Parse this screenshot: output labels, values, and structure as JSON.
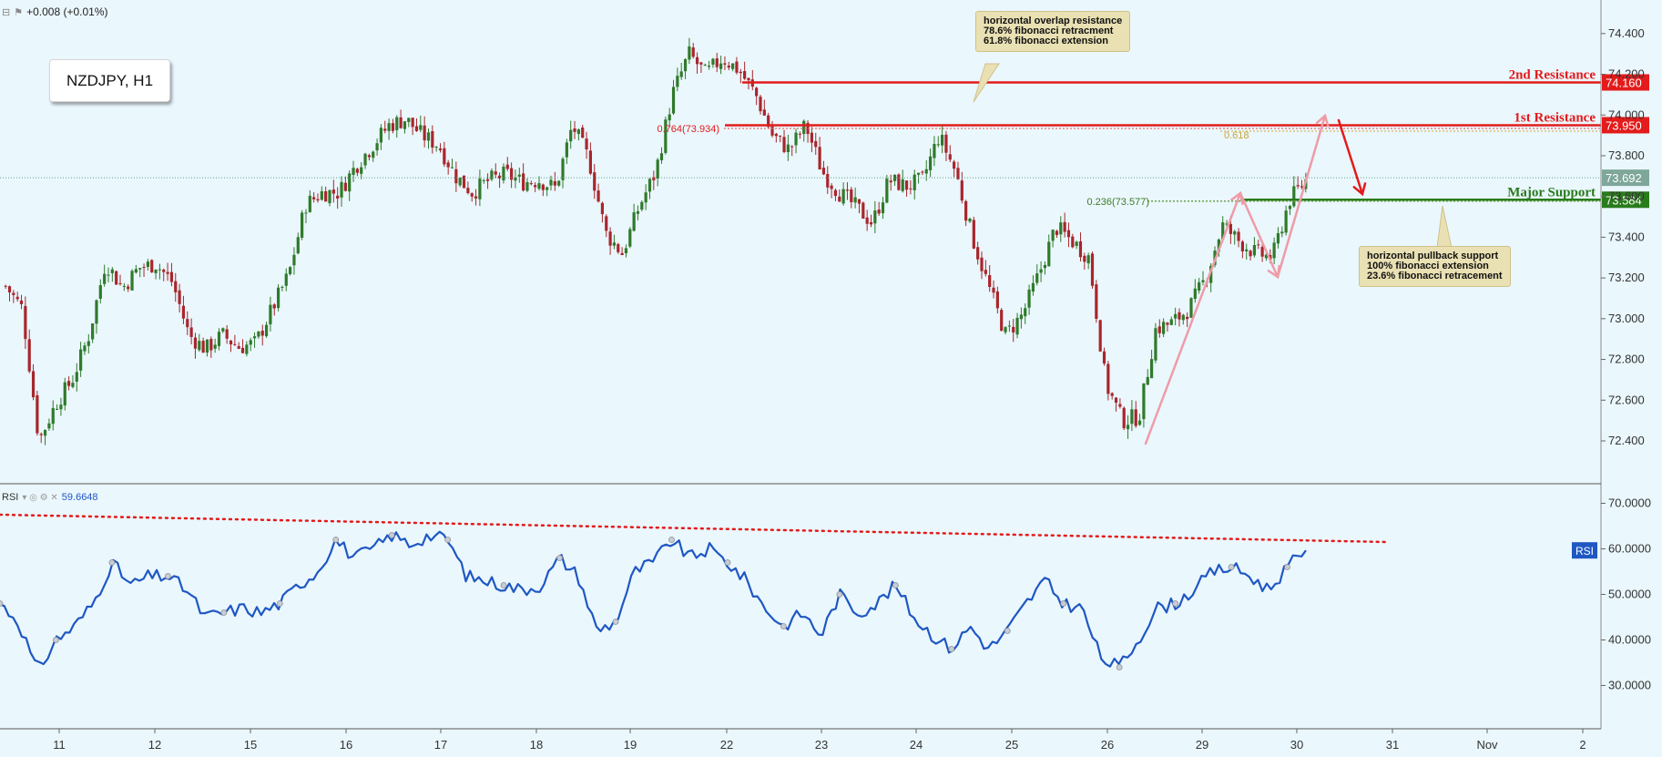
{
  "header": {
    "change": "+0.008 (+0.01%)",
    "symbol": "NZDJPY, H1"
  },
  "annotations": {
    "resistance_note": [
      "horizontal overlap resistance",
      "78.6% fibonacci retracment",
      "61.8% fibonacci extension"
    ],
    "support_note": [
      "horizontal pullback support",
      "100% fibonacci extension",
      "23.6% fibonacci retracement"
    ],
    "fib_786": "0.764(73.934)",
    "fib_618": "0.618",
    "fib_236": "0.236(73.577)"
  },
  "colors": {
    "background": "#eaf7fd",
    "bull_candle": "#2f7a2b",
    "bear_candle": "#a8262c",
    "resistance": "#e31b1b",
    "support": "#2a7b1c",
    "rsi_line": "#1f57c3",
    "arrow_pink": "#ee9ca7"
  },
  "rsi": {
    "label": "RSI",
    "value": "59.6648",
    "badge": "RSI"
  },
  "chart_data": {
    "type": "candlestick",
    "title": "NZDJPY, H1",
    "x_ticks": [
      "11",
      "12",
      "15",
      "16",
      "17",
      "18",
      "19",
      "22",
      "23",
      "24",
      "25",
      "26",
      "29",
      "30",
      "31",
      "Nov",
      "2"
    ],
    "price_axis": {
      "ticks": [
        "74.400",
        "74.200",
        "74.000",
        "73.800",
        "73.600",
        "73.400",
        "73.200",
        "73.000",
        "72.800",
        "72.600",
        "72.400"
      ],
      "range": [
        72.23,
        74.52
      ]
    },
    "rsi_axis": {
      "ticks": [
        "70.0000",
        "60.0000",
        "50.0000",
        "40.0000",
        "30.0000"
      ],
      "range": [
        21.5,
        73.5
      ]
    },
    "levels": [
      {
        "name": "2nd Resistance",
        "value": 74.16,
        "label": "74.160",
        "color": "#e31b1b"
      },
      {
        "name": "1st Resistance",
        "value": 73.95,
        "label": "73.950",
        "color": "#e31b1b"
      },
      {
        "name": "Major Support",
        "value": 73.584,
        "label": "73.584",
        "color": "#2a7b1c"
      }
    ],
    "current_price": {
      "value": 73.692,
      "label": "73.692"
    },
    "price_path": [
      [
        0,
        73.16
      ],
      [
        1,
        73.05
      ],
      [
        2,
        72.4
      ],
      [
        3,
        72.58
      ],
      [
        4,
        72.7
      ],
      [
        5,
        72.92
      ],
      [
        6,
        73.28
      ],
      [
        7,
        73.15
      ],
      [
        8,
        73.25
      ],
      [
        9,
        73.27
      ],
      [
        10,
        73.18
      ],
      [
        11,
        72.92
      ],
      [
        12,
        72.85
      ],
      [
        13,
        72.92
      ],
      [
        14,
        72.86
      ],
      [
        15,
        72.88
      ],
      [
        16,
        73.05
      ],
      [
        17,
        73.22
      ],
      [
        18,
        73.56
      ],
      [
        19,
        73.62
      ],
      [
        20,
        73.62
      ],
      [
        21,
        73.75
      ],
      [
        22,
        73.85
      ],
      [
        23,
        73.95
      ],
      [
        24,
        73.98
      ],
      [
        25,
        73.9
      ],
      [
        26,
        73.85
      ],
      [
        27,
        73.7
      ],
      [
        28,
        73.62
      ],
      [
        29,
        73.68
      ],
      [
        30,
        73.71
      ],
      [
        31,
        73.67
      ],
      [
        32,
        73.68
      ],
      [
        33,
        73.64
      ],
      [
        34,
        73.95
      ],
      [
        35,
        73.78
      ],
      [
        36,
        73.42
      ],
      [
        37,
        73.32
      ],
      [
        38,
        73.55
      ],
      [
        39,
        73.72
      ],
      [
        40,
        74.1
      ],
      [
        41,
        74.3
      ],
      [
        42,
        74.2
      ],
      [
        43,
        74.28
      ],
      [
        44,
        74.22
      ],
      [
        45,
        74.1
      ],
      [
        46,
        73.9
      ],
      [
        47,
        73.83
      ],
      [
        48,
        73.95
      ],
      [
        49,
        73.72
      ],
      [
        50,
        73.62
      ],
      [
        51,
        73.55
      ],
      [
        52,
        73.47
      ],
      [
        53,
        73.68
      ],
      [
        54,
        73.65
      ],
      [
        55,
        73.68
      ],
      [
        56,
        73.9
      ],
      [
        57,
        73.72
      ],
      [
        58,
        73.4
      ],
      [
        59,
        73.15
      ],
      [
        60,
        72.92
      ],
      [
        61,
        73.02
      ],
      [
        62,
        73.22
      ],
      [
        63,
        73.45
      ],
      [
        64,
        73.38
      ],
      [
        65,
        73.3
      ],
      [
        66,
        72.68
      ],
      [
        67,
        72.5
      ],
      [
        68,
        72.52
      ],
      [
        69,
        72.95
      ],
      [
        70,
        72.98
      ],
      [
        71,
        73.05
      ],
      [
        72,
        73.2
      ],
      [
        73,
        73.46
      ],
      [
        74,
        73.38
      ],
      [
        75,
        73.32
      ],
      [
        76,
        73.3
      ],
      [
        77,
        73.58
      ],
      [
        78,
        73.68
      ]
    ],
    "rsi_series": [
      [
        0,
        48
      ],
      [
        1,
        44
      ],
      [
        2,
        33
      ],
      [
        3,
        40
      ],
      [
        4,
        43
      ],
      [
        5,
        48
      ],
      [
        6,
        57
      ],
      [
        7,
        52
      ],
      [
        8,
        54
      ],
      [
        9,
        54
      ],
      [
        10,
        51
      ],
      [
        11,
        45
      ],
      [
        12,
        46
      ],
      [
        13,
        47
      ],
      [
        14,
        46
      ],
      [
        15,
        48
      ],
      [
        16,
        52
      ],
      [
        17,
        55
      ],
      [
        18,
        62
      ],
      [
        19,
        58
      ],
      [
        20,
        60
      ],
      [
        21,
        63
      ],
      [
        22,
        61
      ],
      [
        23,
        63
      ],
      [
        24,
        62
      ],
      [
        25,
        54
      ],
      [
        26,
        53
      ],
      [
        27,
        52
      ],
      [
        28,
        51
      ],
      [
        29,
        52
      ],
      [
        30,
        58
      ],
      [
        31,
        54
      ],
      [
        32,
        42
      ],
      [
        33,
        44
      ],
      [
        34,
        55
      ],
      [
        35,
        57
      ],
      [
        36,
        62
      ],
      [
        37,
        58
      ],
      [
        38,
        60
      ],
      [
        39,
        57
      ],
      [
        40,
        53
      ],
      [
        41,
        47
      ],
      [
        42,
        43
      ],
      [
        43,
        46
      ],
      [
        44,
        41
      ],
      [
        45,
        50
      ],
      [
        46,
        46
      ],
      [
        47,
        48
      ],
      [
        48,
        52
      ],
      [
        49,
        45
      ],
      [
        50,
        41
      ],
      [
        51,
        38
      ],
      [
        52,
        43
      ],
      [
        53,
        38
      ],
      [
        54,
        42
      ],
      [
        55,
        48
      ],
      [
        56,
        53
      ],
      [
        57,
        48
      ],
      [
        58,
        47
      ],
      [
        59,
        36
      ],
      [
        60,
        34
      ],
      [
        61,
        40
      ],
      [
        62,
        47
      ],
      [
        63,
        48
      ],
      [
        64,
        51
      ],
      [
        65,
        55
      ],
      [
        66,
        56
      ],
      [
        67,
        54
      ],
      [
        68,
        51
      ],
      [
        69,
        56
      ],
      [
        70,
        59.66
      ]
    ],
    "rsi_trendline": {
      "from": [
        0,
        67.5
      ],
      "to": [
        70,
        61.5
      ]
    }
  }
}
